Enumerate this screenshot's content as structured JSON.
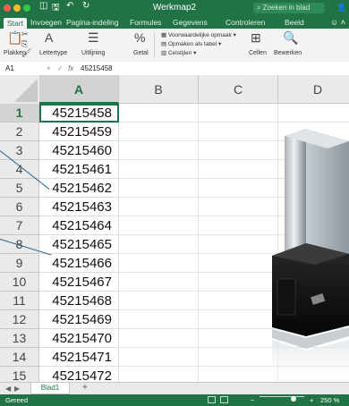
{
  "window": {
    "title": "Werkmap2",
    "search_placeholder": "Zoeken in blad",
    "quick_access": [
      "◫",
      "🖫",
      "↶",
      "↻"
    ],
    "share_icon": "person-plus-icon"
  },
  "ribbon_tabs": [
    "Start",
    "Invoegen",
    "Pagina-indeling",
    "Formules",
    "Gegevens",
    "Controleren",
    "Beeld"
  ],
  "ribbon": {
    "paste": "Plakken",
    "font": "Lettertype",
    "alignment": "Uitlijning",
    "number": "Getal",
    "cond_format": "Voorwaardelijke opmaak",
    "format_table": "Opmaken als tabel",
    "cell_styles": "Celstijlen",
    "cells": "Cellen",
    "editing": "Bewerken"
  },
  "formula_bar": {
    "cell_ref": "A1",
    "fx": "fx",
    "value": "45215458"
  },
  "columns": [
    "A",
    "B",
    "C",
    "D"
  ],
  "rows": [
    {
      "num": "1",
      "a": "45215458"
    },
    {
      "num": "2",
      "a": "45215459"
    },
    {
      "num": "3",
      "a": "45215460"
    },
    {
      "num": "4",
      "a": "45215461"
    },
    {
      "num": "5",
      "a": "45215462"
    },
    {
      "num": "6",
      "a": "45215463"
    },
    {
      "num": "7",
      "a": "45215464"
    },
    {
      "num": "8",
      "a": "45215465"
    },
    {
      "num": "9",
      "a": "45215466"
    },
    {
      "num": "10",
      "a": "45215467"
    },
    {
      "num": "11",
      "a": "45215468"
    },
    {
      "num": "12",
      "a": "45215469"
    },
    {
      "num": "13",
      "a": "45215470"
    },
    {
      "num": "14",
      "a": "45215471"
    },
    {
      "num": "15",
      "a": "45215472"
    }
  ],
  "sheet_tabs": [
    "Blad1"
  ],
  "status": {
    "ready": "Gereed",
    "zoom": "250 %"
  },
  "colors": {
    "accent": "#217346"
  }
}
